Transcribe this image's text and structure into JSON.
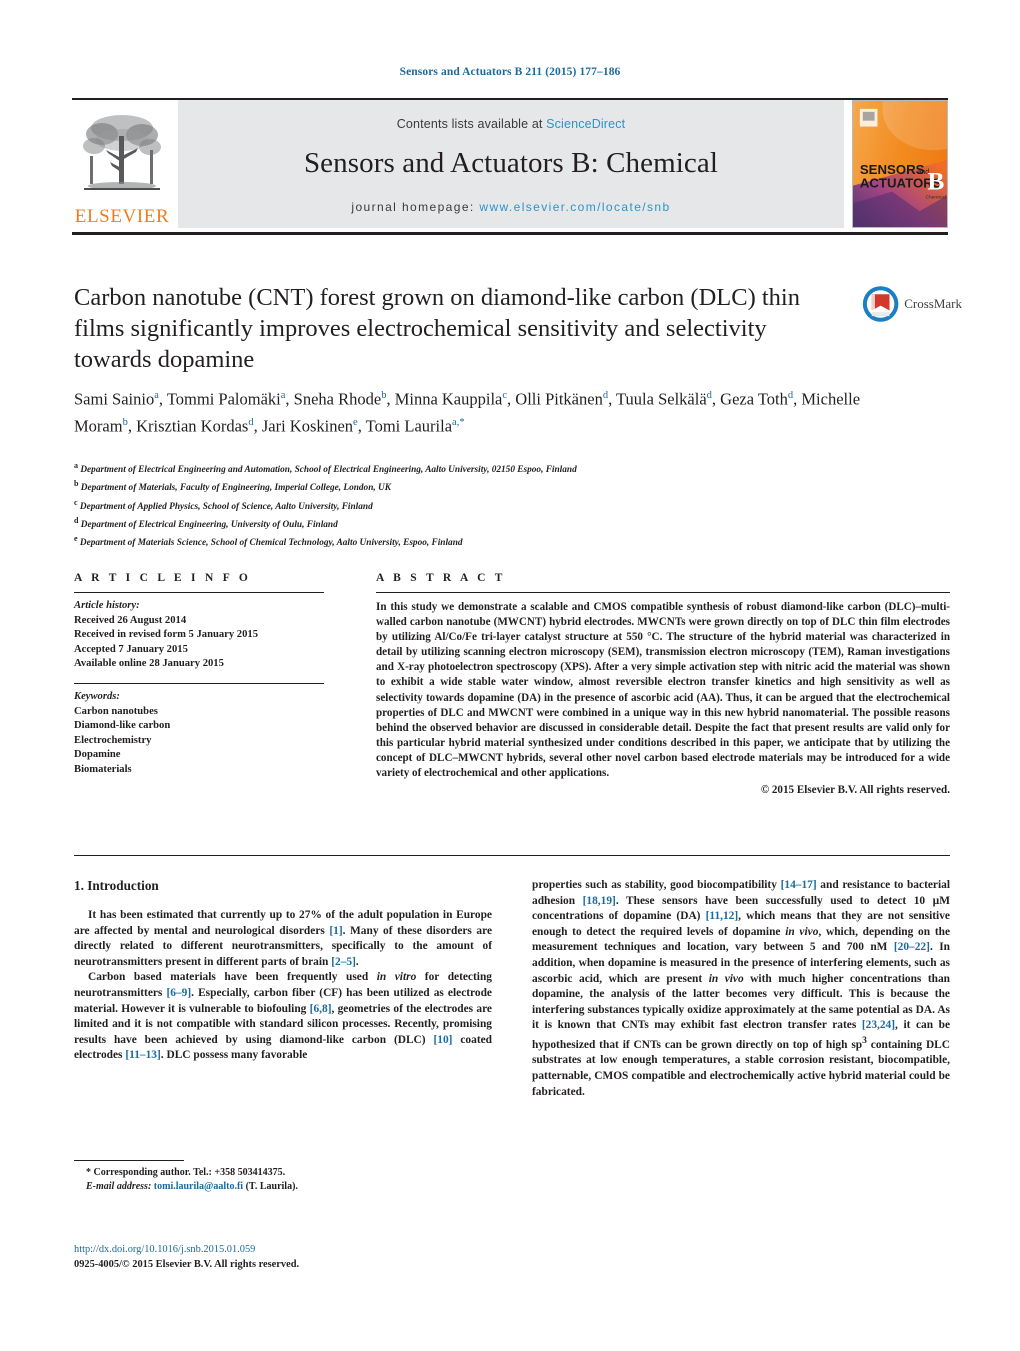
{
  "running_head": "Sensors and Actuators B 211 (2015) 177–186",
  "masthead": {
    "elsevier_wordmark": "ELSEVIER",
    "contents_prefix": "Contents lists available at ",
    "contents_link": "ScienceDirect",
    "journal_name": "Sensors and Actuators B: Chemical",
    "homepage_label": "journal homepage:",
    "homepage_url": "www.elsevier.com/locate/snb",
    "cover": {
      "line1": "SENSORS",
      "line1_small": "and",
      "line2": "ACTUATORS",
      "letter": "B",
      "letter_sub": "Chemical"
    }
  },
  "article": {
    "title": "Carbon nanotube (CNT) forest grown on diamond-like carbon (DLC) thin films significantly improves electrochemical sensitivity and selectivity towards dopamine",
    "crossmark_label": "CrossMark",
    "authors": [
      {
        "name": "Sami Sainio",
        "marks": "a",
        "sep": ", "
      },
      {
        "name": "Tommi Palomäki",
        "marks": "a",
        "sep": ", "
      },
      {
        "name": "Sneha Rhode",
        "marks": "b",
        "sep": ", "
      },
      {
        "name": "Minna Kauppila",
        "marks": "c",
        "sep": ", "
      },
      {
        "name": "Olli Pitkänen",
        "marks": "d",
        "sep": ", "
      },
      {
        "name": "Tuula Selkälä",
        "marks": "d",
        "sep": ", "
      },
      {
        "name": "Geza Toth",
        "marks": "d",
        "sep": ", "
      },
      {
        "name": "Michelle Moram",
        "marks": "b",
        "sep": ", "
      },
      {
        "name": "Krisztian Kordas",
        "marks": "d",
        "sep": ", "
      },
      {
        "name": "Jari Koskinen",
        "marks": "e",
        "sep": ", "
      },
      {
        "name": "Tomi Laurila",
        "marks": "a,*",
        "sep": ""
      }
    ],
    "affiliations": [
      {
        "mark": "a",
        "text": "Department of Electrical Engineering and Automation, School of Electrical Engineering, Aalto University, 02150 Espoo, Finland"
      },
      {
        "mark": "b",
        "text": "Department of Materials, Faculty of Engineering, Imperial College, London, UK"
      },
      {
        "mark": "c",
        "text": "Department of Applied Physics, School of Science, Aalto University, Finland"
      },
      {
        "mark": "d",
        "text": "Department of Electrical Engineering, University of Oulu, Finland"
      },
      {
        "mark": "e",
        "text": "Department of Materials Science, School of Chemical Technology, Aalto University, Espoo, Finland"
      }
    ]
  },
  "article_info": {
    "heading": "A R T I C L E    I N F O",
    "history_label": "Article history:",
    "history": [
      "Received 26 August 2014",
      "Received in revised form 5 January 2015",
      "Accepted 7 January 2015",
      "Available online 28 January 2015"
    ],
    "keywords_label": "Keywords:",
    "keywords": [
      "Carbon nanotubes",
      "Diamond-like carbon",
      "Electrochemistry",
      "Dopamine",
      "Biomaterials"
    ]
  },
  "abstract": {
    "heading": "A B S T R A C T",
    "text": "In this study we demonstrate a scalable and CMOS compatible synthesis of robust diamond-like carbon (DLC)–multi-walled carbon nanotube (MWCNT) hybrid electrodes. MWCNTs were grown directly on top of DLC thin film electrodes by utilizing Al/Co/Fe tri-layer catalyst structure at 550 °C. The structure of the hybrid material was characterized in detail by utilizing scanning electron microscopy (SEM), transmission electron microscopy (TEM), Raman investigations and X-ray photoelectron spectroscopy (XPS). After a very simple activation step with nitric acid the material was shown to exhibit a wide stable water window, almost reversible electron transfer kinetics and high sensitivity as well as selectivity towards dopamine (DA) in the presence of ascorbic acid (AA). Thus, it can be argued that the electrochemical properties of DLC and MWCNT were combined in a unique way in this new hybrid nanomaterial. The possible reasons behind the observed behavior are discussed in considerable detail. Despite the fact that present results are valid only for this particular hybrid material synthesized under conditions described in this paper, we anticipate that by utilizing the concept of DLC–MWCNT hybrids, several other novel carbon based electrode materials may be introduced for a wide variety of electrochemical and other applications.",
    "copyright": "© 2015 Elsevier B.V. All rights reserved."
  },
  "body": {
    "section_number_title": "1.  Introduction",
    "left_paragraphs": [
      "It has been estimated that currently up to 27% of the adult population in Europe are affected by mental and neurological disorders [1]. Many of these disorders are directly related to different neurotransmitters, specifically to the amount of neurotransmitters present in different parts of brain [2–5].",
      "Carbon based materials have been frequently used in vitro for detecting neurotransmitters [6–9]. Especially, carbon fiber (CF) has been utilized as electrode material. However it is vulnerable to biofouling [6,8], geometries of the electrodes are limited and it is not compatible with standard silicon processes. Recently, promising results have been achieved by using diamond-like carbon (DLC) [10] coated electrodes [11–13]. DLC possess many favorable"
    ],
    "right_paragraphs": [
      "properties such as stability, good biocompatibility [14–17] and resistance to bacterial adhesion [18,19]. These sensors have been successfully used to detect 10 µM concentrations of dopamine (DA) [11,12], which means that they are not sensitive enough to detect the required levels of dopamine in vivo, which, depending on the measurement techniques and location, vary between 5 and 700 nM [20–22]. In addition, when dopamine is measured in the presence of interfering elements, such as ascorbic acid, which are present in vivo with much higher concentrations than dopamine, the analysis of the latter becomes very difficult. This is because the interfering substances typically oxidize approximately at the same potential as DA. As it is known that CNTs may exhibit fast electron transfer rates [23,24], it can be hypothesized that if CNTs can be grown directly on top of high sp3 containing DLC substrates at low enough temperatures, a stable corrosion resistant, biocompatible, patternable, CMOS compatible and electrochemically active hybrid material could be fabricated."
    ]
  },
  "footnote": {
    "corresponding": "* Corresponding author. Tel.: +358 503414375.",
    "email_label": "E-mail address:",
    "email": "tomi.laurila@aalto.fi",
    "email_suffix": "(T. Laurila)."
  },
  "footer": {
    "doi": "http://dx.doi.org/10.1016/j.snb.2015.01.059",
    "issn_copyright": "0925-4005/© 2015 Elsevier B.V. All rights reserved."
  },
  "colors": {
    "link": "#1b6a9c",
    "sciencedirect": "#2d93c8",
    "elsevier_orange": "#f07c21",
    "banner_bg": "#e6e7e8",
    "text": "#231f20"
  }
}
